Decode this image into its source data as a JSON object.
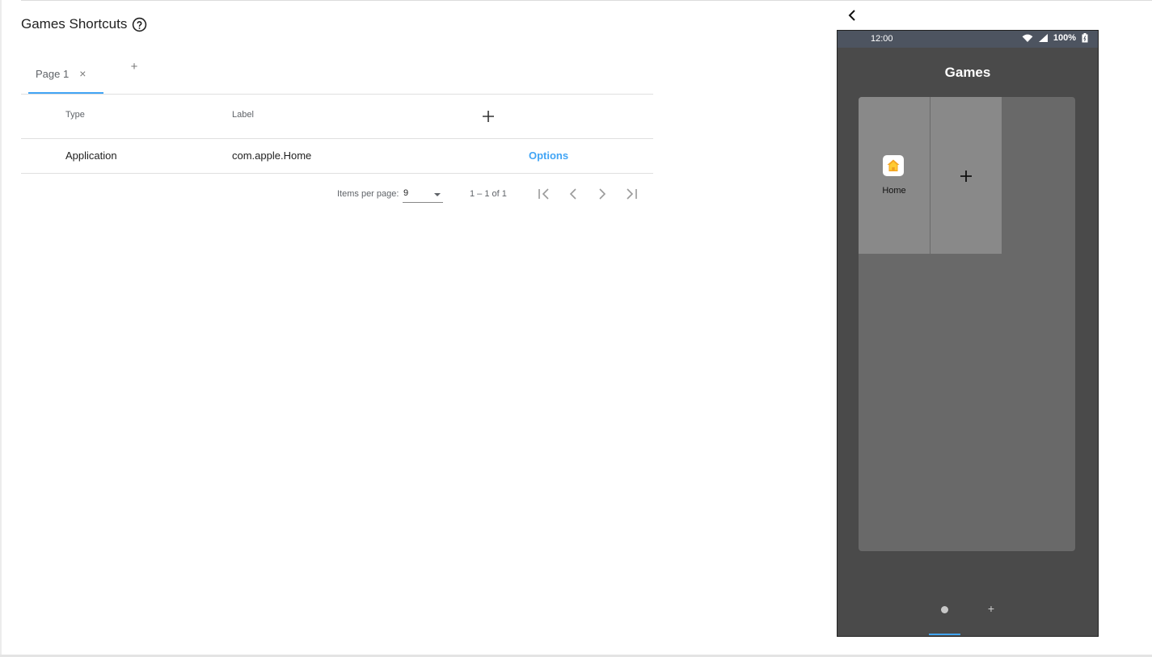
{
  "header": {
    "title": "Games Shortcuts",
    "help_icon": "help-circle-icon"
  },
  "tabs": [
    {
      "label": "Page 1",
      "close": "×"
    }
  ],
  "tab_add_label": "+",
  "table": {
    "columns": [
      "Type",
      "Label"
    ],
    "add_column_icon": "plus-icon",
    "rows": [
      {
        "type": "Application",
        "label": "com.apple.Home",
        "action": "Options"
      }
    ]
  },
  "paginator": {
    "items_per_page_label": "Items per page:",
    "items_per_page": "9",
    "range": "1 – 1 of 1"
  },
  "preview": {
    "status_bar": {
      "time": "12:00",
      "battery": "100%"
    },
    "title": "Games",
    "apps": [
      {
        "label": "Home",
        "icon": "home-app-icon"
      }
    ],
    "add_cell_icon": "plus-icon",
    "page_add_label": "+"
  },
  "colors": {
    "accent": "#42a5f5",
    "phone_bg": "#4a4a4a",
    "status_bar": "#4d5460",
    "panel": "#696969",
    "cell": "#898989"
  }
}
